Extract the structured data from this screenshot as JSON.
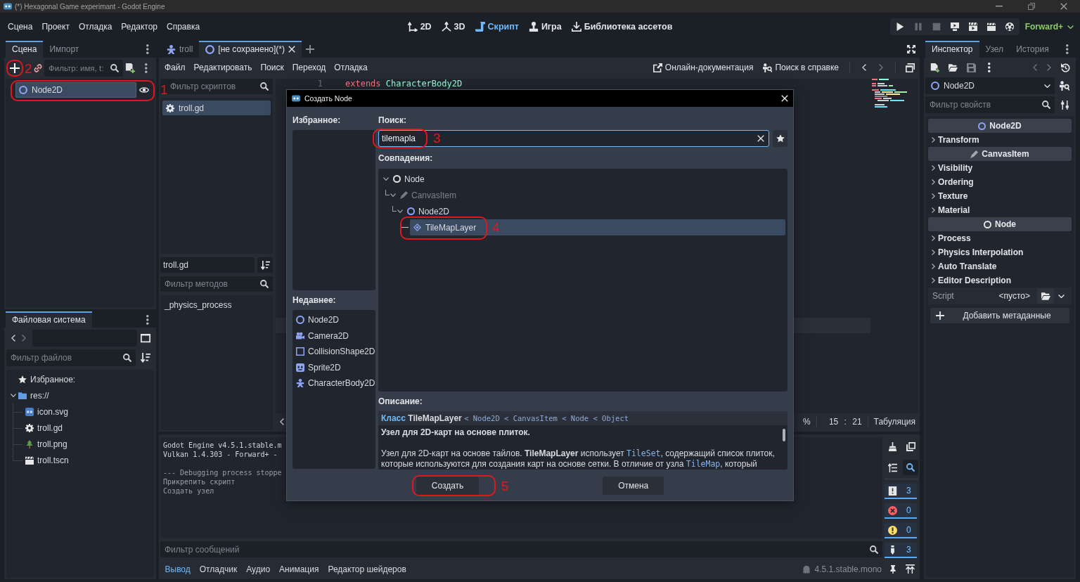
{
  "window": {
    "title": "(*) Hexagonal Game experimant - Godot Engine"
  },
  "main_menu": [
    "Сцена",
    "Проект",
    "Отладка",
    "Редактор",
    "Справка"
  ],
  "workspaces": [
    {
      "label": "2D",
      "kind": "flat",
      "selected": false
    },
    {
      "label": "3D",
      "kind": "spatial",
      "selected": false
    },
    {
      "label": "Скрипт",
      "kind": "script",
      "selected": true
    },
    {
      "label": "Игра",
      "kind": "game",
      "selected": false
    },
    {
      "label": "Библиотека ассетов",
      "kind": "assets",
      "selected": false
    }
  ],
  "run_bar": [
    {
      "kind": "play",
      "disabled": false
    },
    {
      "kind": "pause",
      "disabled": true
    },
    {
      "kind": "stop",
      "disabled": true
    },
    {
      "kind": "remote",
      "disabled": false
    },
    {
      "kind": "current",
      "disabled": false
    },
    {
      "kind": "custom",
      "disabled": false
    },
    {
      "kind": "movie",
      "disabled": false
    }
  ],
  "renderer": "Forward+",
  "scene_dock": {
    "tabs": [
      {
        "label": "Сцена",
        "selected": true
      },
      {
        "label": "Импорт",
        "selected": false
      }
    ],
    "add_node": {
      "annotation": "2"
    },
    "filter": {
      "placeholder": "Фильтр: имя, t:"
    },
    "nodes": [
      {
        "label": "Node2D",
        "kind": "node2d",
        "selected": true,
        "annotation": "1"
      }
    ]
  },
  "filesystem_dock": {
    "tabs": [
      {
        "label": "Файловая система",
        "selected": true
      }
    ],
    "filter": {
      "placeholder": "Фильтр файлов"
    },
    "tree": [
      {
        "label": "Избранное:",
        "kind": "favorites"
      },
      {
        "label": "res://",
        "kind": "folder",
        "expanded": true,
        "children": [
          {
            "label": "icon.svg",
            "kind": "svg"
          },
          {
            "label": "troll.gd",
            "kind": "script"
          },
          {
            "label": "troll.png",
            "kind": "png"
          },
          {
            "label": "troll.tscn",
            "kind": "scene"
          }
        ]
      }
    ]
  },
  "script_editor": {
    "tabs": [
      {
        "label": "troll",
        "kind": "characterbody2d",
        "selected": false
      },
      {
        "label": "[не сохранено](*)",
        "kind": "node2d",
        "selected": true
      }
    ],
    "menu": [
      "Файл",
      "Редактировать",
      "Поиск",
      "Переход",
      "Отладка"
    ],
    "links": [
      {
        "label": "Онлайн-документация",
        "kind": "docs"
      },
      {
        "label": "Поиск в справке",
        "kind": "help"
      }
    ],
    "script_filter": {
      "placeholder": "Фильтр скриптов"
    },
    "scripts": [
      {
        "label": "troll.gd",
        "selected": true
      }
    ],
    "current_script": "troll.gd",
    "method_filter": {
      "placeholder": "Фильтр методов"
    },
    "methods": [
      "_physics_process"
    ],
    "code": [
      {
        "number": "1",
        "tokens": [
          {
            "text": "extends",
            "kind": "keyword"
          },
          {
            "text": "CharacterBody2D",
            "kind": "type"
          }
        ]
      }
    ],
    "status": {
      "zoom": "%",
      "caret_position": "15 : 21",
      "indentation": "Табуляция"
    }
  },
  "output": {
    "log": [
      {
        "kind": "engine",
        "lines": [
          "Godot Engine v4.5.1.stable.m",
          "Vulkan 1.4.303 - Forward+ -"
        ]
      },
      {
        "kind": "editor",
        "lines": [
          "--- Debugging process stoppe",
          "Прикрепить скрипт",
          "Создать узел"
        ]
      }
    ],
    "filter": {
      "placeholder": "Фильтр сообщений"
    },
    "search_toggle": {
      "on": true
    },
    "counters": [
      {
        "kind": "message",
        "count": "3",
        "on": true
      },
      {
        "kind": "error",
        "count": "0",
        "on": true
      },
      {
        "kind": "warning",
        "count": "0",
        "on": true
      },
      {
        "kind": "editor",
        "count": "3",
        "on": true
      }
    ],
    "tabs": [
      {
        "label": "Вывод",
        "selected": true
      },
      {
        "label": "Отладчик",
        "selected": false
      },
      {
        "label": "Аудио",
        "selected": false
      },
      {
        "label": "Анимация",
        "selected": false
      },
      {
        "label": "Редактор шейдеров",
        "selected": false
      }
    ],
    "version": "4.5.1.stable.mono"
  },
  "inspector": {
    "tabs": [
      {
        "label": "Инспектор",
        "selected": true
      },
      {
        "label": "Узел",
        "selected": false
      },
      {
        "label": "История",
        "selected": false
      }
    ],
    "object": {
      "label": "Node2D",
      "kind": "node2d"
    },
    "filter": {
      "placeholder": "Фильтр свойств"
    },
    "categories": [
      {
        "label": "Node2D",
        "kind": "node2d",
        "groups": [
          {
            "label": "Transform",
            "expanded": false
          }
        ]
      },
      {
        "label": "CanvasItem",
        "kind": "canvasitem",
        "groups": [
          {
            "label": "Visibility",
            "expanded": false
          },
          {
            "label": "Ordering",
            "expanded": false
          },
          {
            "label": "Texture",
            "expanded": false
          },
          {
            "label": "Material",
            "expanded": false
          }
        ]
      },
      {
        "label": "Node",
        "kind": "node",
        "groups": [
          {
            "label": "Process",
            "expanded": false
          },
          {
            "label": "Physics Interpolation",
            "expanded": false
          },
          {
            "label": "Auto Translate",
            "expanded": false
          },
          {
            "label": "Editor Description",
            "expanded": false
          }
        ]
      }
    ],
    "script": {
      "label": "Script",
      "value": "<пусто>"
    },
    "add_metadata": "Добавить метаданные"
  },
  "create_dialog": {
    "title": "Создать Node",
    "favorites": {
      "label": "Избранное:"
    },
    "recent": {
      "label": "Недавнее:",
      "items": [
        {
          "label": "Node2D",
          "kind": "node2d"
        },
        {
          "label": "Camera2D",
          "kind": "camera2d"
        },
        {
          "label": "CollisionShape2D",
          "kind": "collisionshape2d"
        },
        {
          "label": "Sprite2D",
          "kind": "sprite2d"
        },
        {
          "label": "CharacterBody2D",
          "kind": "characterbody2d"
        }
      ]
    },
    "search": {
      "label": "Поиск:",
      "value": "tilemapla",
      "annotation": "3"
    },
    "matches": {
      "label": "Совпадения:",
      "tree": [
        {
          "label": "Node",
          "kind": "node",
          "selected": false,
          "disabled": false,
          "expanded": true,
          "children": [
            {
              "label": "CanvasItem",
              "kind": "canvasitem",
              "selected": false,
              "disabled": true,
              "expanded": true,
              "children": [
                {
                  "label": "Node2D",
                  "kind": "node2d",
                  "selected": false,
                  "disabled": false,
                  "expanded": true,
                  "children": [
                    {
                      "label": "TileMapLayer",
                      "kind": "tilemaplayer",
                      "selected": true,
                      "disabled": false,
                      "annotation": "4"
                    }
                  ]
                }
              ]
            }
          ]
        }
      ]
    },
    "description": {
      "label": "Описание:",
      "class_keyword": "Класс",
      "class_name": "TileMapLayer",
      "inheritance": "< Node2D < CanvasItem < Node < Object",
      "brief": "Узел для 2D-карт на основе плиток.",
      "body": [
        {
          "text": "Узел для 2D-карт на основе тайлов. **TileMapLayer** использует ",
          "kind": "text"
        },
        {
          "text": "TileSet",
          "kind": "code"
        },
        {
          "text": ", содержащий список плиток, которые используются для создания карт на основе сетки. В отличие от узла ",
          "kind": "text"
        },
        {
          "text": "TileMap",
          "kind": "code"
        },
        {
          "text": ", который",
          "kind": "text"
        }
      ]
    },
    "buttons": [
      {
        "label": "Создать",
        "annotation": "5"
      },
      {
        "label": "Отмена"
      }
    ]
  }
}
